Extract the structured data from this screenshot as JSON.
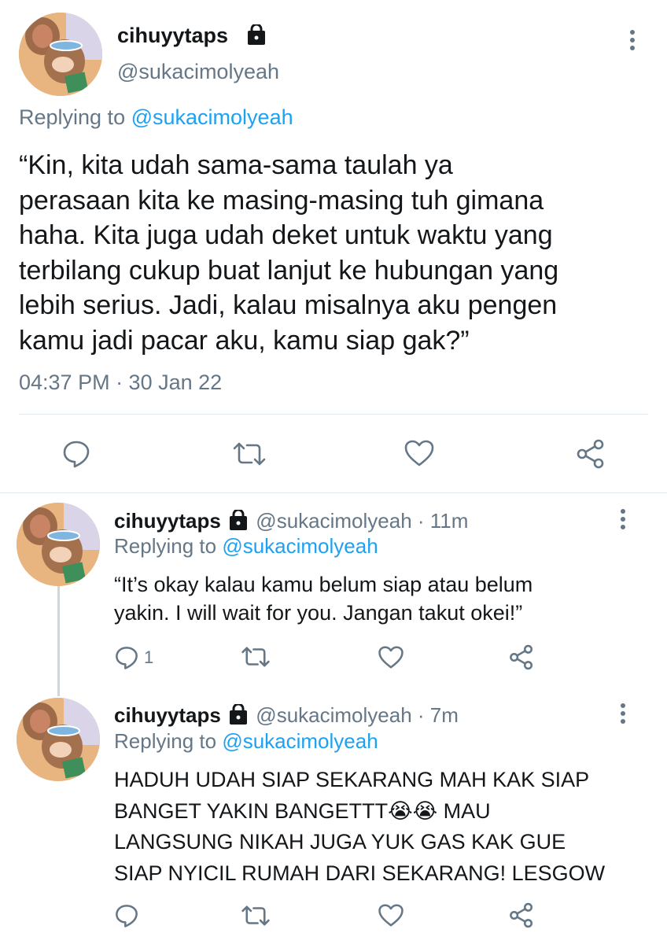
{
  "main_tweet": {
    "display_name": "cihuyytaps",
    "handle": "@sukacimolyeah",
    "replying_prefix": "Replying to",
    "replying_to": "@sukacimolyeah",
    "text_lines": [
      "“Kin, kita udah sama-sama taulah ya",
      "perasaan kita ke masing-masing tuh gimana",
      "haha. Kita juga udah deket untuk waktu yang",
      "terbilang cukup buat lanjut ke hubungan yang",
      "lebih serius. Jadi, kalau misalnya aku pengen",
      "kamu jadi pacar aku, kamu siap gak?”"
    ],
    "timestamp": "04:37 PM · 30 Jan 22",
    "icons": [
      "reply-icon",
      "retweet-icon",
      "like-icon",
      "share-icon"
    ]
  },
  "replies": [
    {
      "display_name": "cihuyytaps",
      "meta": "@sukacimolyeah · 11m",
      "replying_prefix": "Replying to",
      "replying_to": "@sukacimolyeah",
      "text_lines": [
        "“It’s okay kalau kamu belum siap atau belum",
        "yakin. I will wait for you. Jangan takut okei!”"
      ],
      "reply_count": "1"
    },
    {
      "display_name": "cihuyytaps",
      "meta": "@sukacimolyeah · 7m",
      "replying_prefix": "Replying to",
      "replying_to": "@sukacimolyeah",
      "text_lines": [
        "HADUH UDAH SIAP SEKARANG MAH KAK SIAP",
        "BANGET YAKIN BANGETTT😭😭 MAU",
        "LANGSUNG NIKAH JUGA YUK GAS KAK GUE",
        "SIAP NYICIL RUMAH DARI SEKARANG! LESGOW"
      ],
      "reply_count": ""
    }
  ],
  "colors": {
    "link": "#1da1f2",
    "secondary_text": "#657786",
    "divider": "#e1e8ed",
    "thread_line": "#ccd6dd"
  }
}
